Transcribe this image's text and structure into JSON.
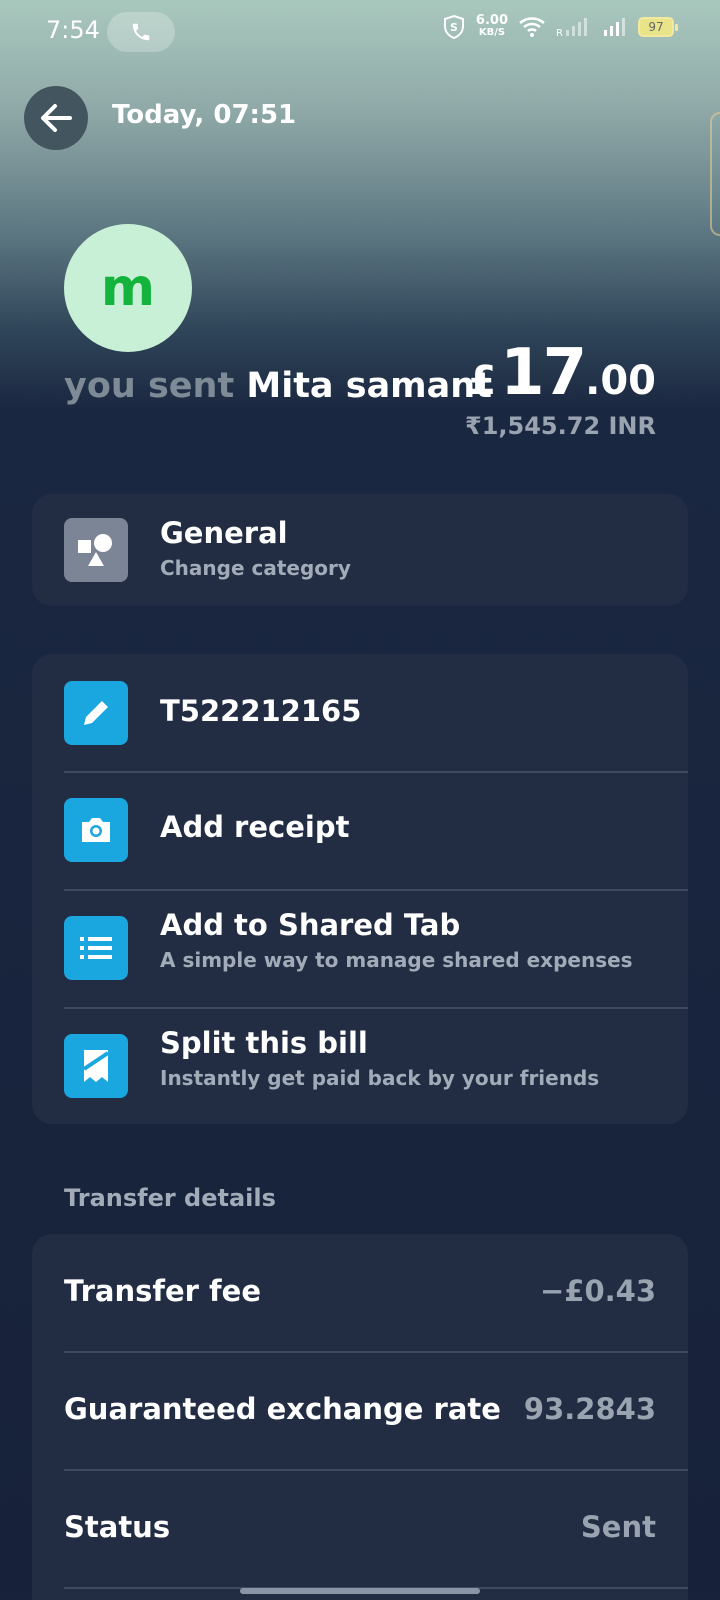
{
  "status_bar": {
    "time": "7:54",
    "net_speed_value": "6.00",
    "net_speed_unit": "KB/S",
    "battery": "97"
  },
  "header": {
    "date": "Today, 07:51"
  },
  "recipient": {
    "initial": "m",
    "sent_prefix": "you sent",
    "name": "Mita samant"
  },
  "amount": {
    "symbol": "£",
    "integer": "17",
    "decimal": ".00",
    "converted": "₹1,545.72 INR"
  },
  "category": {
    "title": "General",
    "subtitle": "Change category",
    "icon": "shapes-icon"
  },
  "actions": [
    {
      "title": "T522212165",
      "subtitle": "",
      "icon": "pencil-icon"
    },
    {
      "title": "Add receipt",
      "subtitle": "",
      "icon": "camera-icon"
    },
    {
      "title": "Add to Shared Tab",
      "subtitle": "A simple way to manage shared expenses",
      "icon": "list-icon"
    },
    {
      "title": "Split this bill",
      "subtitle": "Instantly get paid back by your friends",
      "icon": "receipt-icon"
    }
  ],
  "transfer_details": {
    "label": "Transfer details",
    "rows": [
      {
        "label": "Transfer fee",
        "value": "−£0.43"
      },
      {
        "label": "Guaranteed exchange rate",
        "value": "93.2843"
      },
      {
        "label": "Status",
        "value": "Sent"
      }
    ]
  },
  "colors": {
    "accent_blue": "#1aa7e0",
    "avatar_bg": "#c8f0d6",
    "avatar_fg": "#14b33c",
    "card_bg": "#222d44"
  }
}
